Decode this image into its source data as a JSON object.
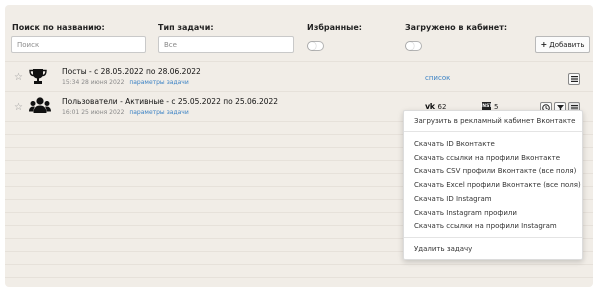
{
  "filters": {
    "search_label": "Поиск по названию:",
    "search_placeholder": "Поиск",
    "type_label": "Тип задачи:",
    "type_value": "Все",
    "favorites_label": "Избранные:",
    "uploaded_label": "Загружено в кабинет:",
    "add_button": "Добавить"
  },
  "tasks": [
    {
      "title": "Посты - с 28.05.2022 по 28.06.2022",
      "time": "15:34 28 июня 2022",
      "params_link": "параметры задачи",
      "list_link": "список"
    },
    {
      "title": "Пользователи - Активные - с 25.05.2022 по 25.06.2022",
      "time": "16:01 25 июня 2022",
      "params_link": "параметры задачи",
      "vk_label": "vk",
      "vk_count": "62",
      "insta_label": "INST",
      "insta_count": "5"
    }
  ],
  "menu": {
    "upload": "Загрузить в рекламный кабинет Вконтакте",
    "items": [
      "Скачать ID Вконтакте",
      "Скачать ссылки на профили Вконтакте",
      "Скачать CSV профили Вконтакте (все поля)",
      "Скачать Excel профили Вконтакте (все поля)",
      "Скачать ID Instagram",
      "Скачать Instagram профили",
      "Скачать ссылки на профили Instagram"
    ],
    "delete": "Удалить задачу"
  },
  "colors": {
    "panel_bg": "#f1ede7",
    "link": "#3d83c5"
  }
}
